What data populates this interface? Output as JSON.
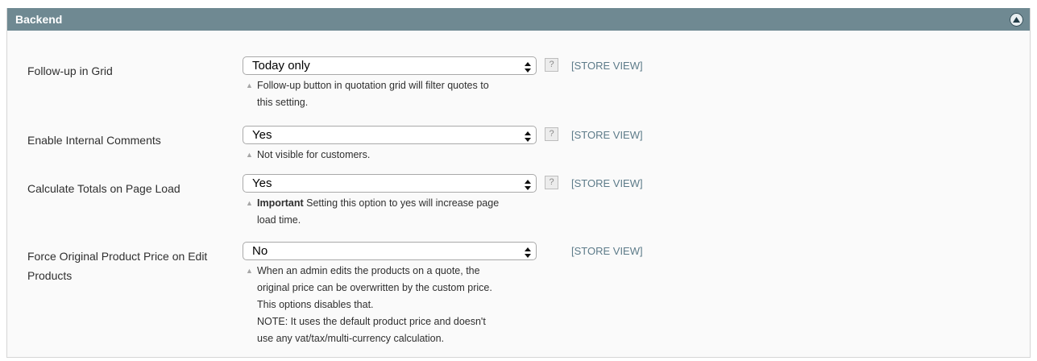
{
  "section": {
    "title": "Backend",
    "collapse_icon": "collapse-up-circle-icon"
  },
  "rows": [
    {
      "label": "Follow-up in Grid",
      "value": "Today only",
      "has_help": true,
      "help_label": "?",
      "scope": "[STORE VIEW]",
      "note_strong": "",
      "note_lines": [
        "Follow-up button in quotation grid will filter quotes to",
        "this setting."
      ]
    },
    {
      "label": "Enable Internal Comments",
      "value": "Yes",
      "has_help": true,
      "help_label": "?",
      "scope": "[STORE VIEW]",
      "note_strong": "",
      "note_lines": [
        "Not visible for customers."
      ]
    },
    {
      "label": "Calculate Totals on Page Load",
      "value": "Yes",
      "has_help": true,
      "help_label": "?",
      "scope": "[STORE VIEW]",
      "note_strong": "Important",
      "note_lines": [
        " Setting this option to yes will increase page",
        "load time."
      ]
    },
    {
      "label": "Force Original Product Price on Edit Products",
      "value": "No",
      "has_help": false,
      "help_label": "",
      "scope": "[STORE VIEW]",
      "note_strong": "",
      "note_lines": [
        "When an admin edits the products on a quote, the",
        "original price can be overwritten by the custom price.",
        "This options disables that.",
        "NOTE: It uses the default product price and doesn't",
        "use any vat/tax/multi-currency calculation."
      ]
    }
  ]
}
